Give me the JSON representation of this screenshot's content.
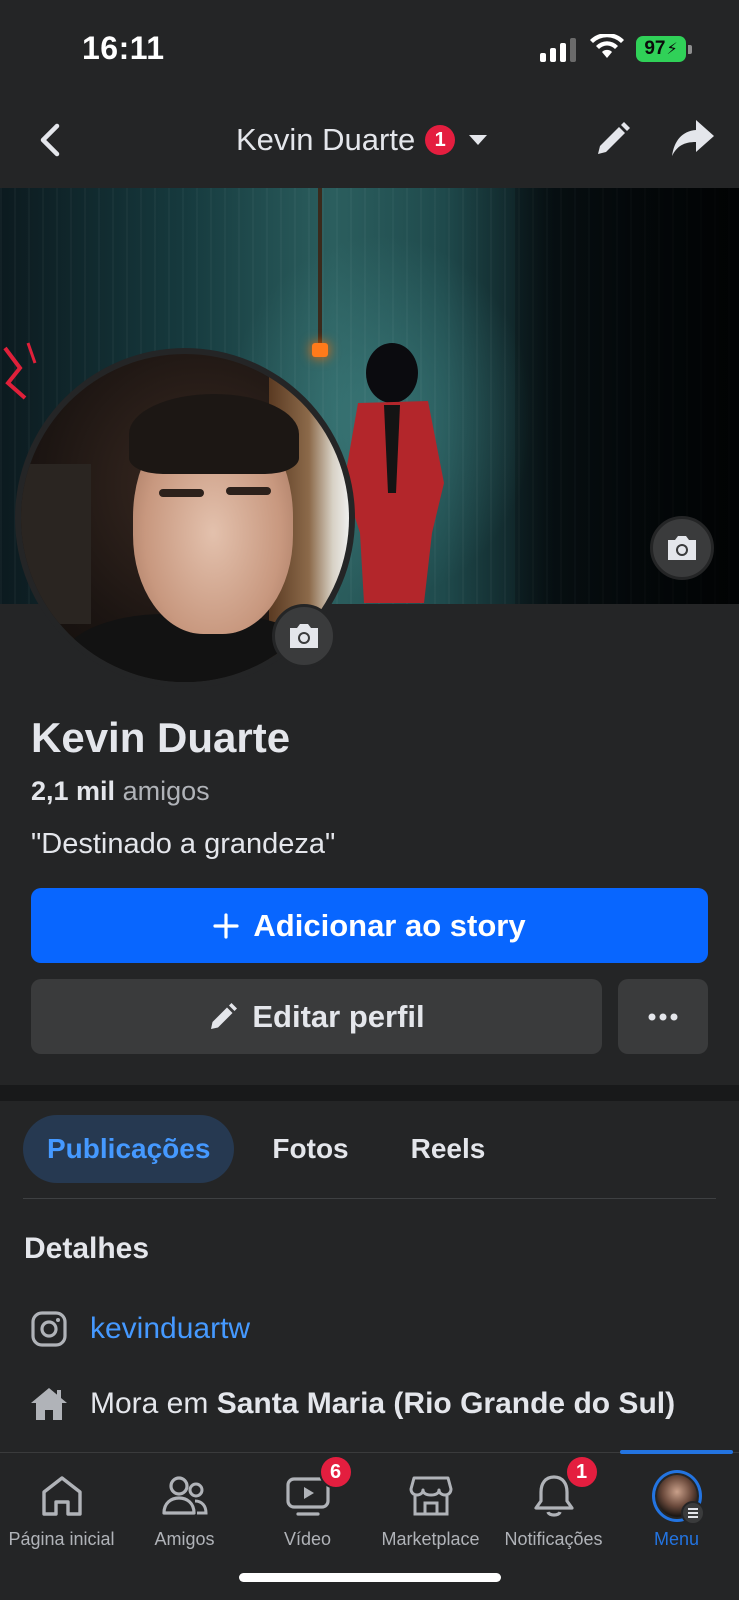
{
  "status_bar": {
    "time": "16:11",
    "battery": "97",
    "battery_color": "#30d158"
  },
  "header": {
    "title": "Kevin Duarte",
    "notification_count": "1",
    "icons": [
      "back-arrow-icon",
      "pencil-icon",
      "share-arrow-icon",
      "caret-down-icon"
    ]
  },
  "profile": {
    "name": "Kevin Duarte",
    "friends_count": "2,1 mil",
    "friends_label": "amigos",
    "bio": "\"Destinado a grandeza\""
  },
  "actions": {
    "add_story_label": "Adicionar ao story",
    "edit_profile_label": "Editar perfil",
    "more_label": "..."
  },
  "tabs": [
    {
      "label": "Publicações",
      "active": true
    },
    {
      "label": "Fotos",
      "active": false
    },
    {
      "label": "Reels",
      "active": false
    }
  ],
  "details": {
    "title": "Detalhes",
    "instagram": "kevinduartw",
    "lives_in_prefix": "Mora em",
    "lives_in_place": "Santa Maria (Rio Grande do Sul)"
  },
  "bottom_nav": [
    {
      "label": "Página inicial",
      "icon": "home-icon",
      "badge": ""
    },
    {
      "label": "Amigos",
      "icon": "friends-icon",
      "badge": ""
    },
    {
      "label": "Vídeo",
      "icon": "video-icon",
      "badge": "6"
    },
    {
      "label": "Marketplace",
      "icon": "marketplace-icon",
      "badge": ""
    },
    {
      "label": "Notificações",
      "icon": "bell-icon",
      "badge": "1"
    },
    {
      "label": "Menu",
      "icon": "avatar",
      "badge": "",
      "active": true
    }
  ],
  "colors": {
    "background": "#242526",
    "accent": "#0866ff",
    "link": "#4599ff",
    "badge": "#e41e3f"
  }
}
